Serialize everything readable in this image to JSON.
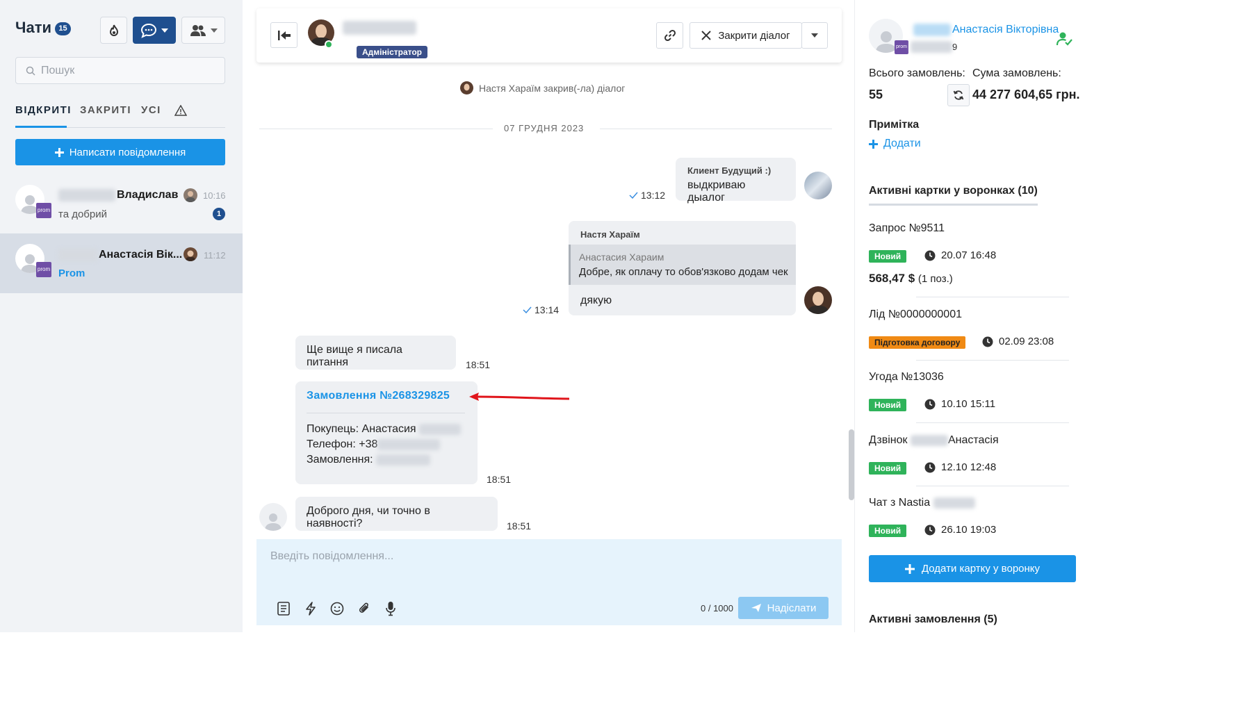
{
  "sidebar": {
    "title": "Чати",
    "chat_count": "15",
    "search_placeholder": "Пошук",
    "tabs": [
      "ВІДКРИТІ",
      "ЗАКРИТІ",
      "УСІ"
    ],
    "new_message_label": "Написати повідомлення",
    "chats": [
      {
        "name": "Владислав",
        "time": "10:16",
        "preview": "та добрий",
        "unread": "1",
        "source": "prom"
      },
      {
        "name": "Анастасія Вік...",
        "time": "11:12",
        "preview": "Prom",
        "source": "prom"
      }
    ]
  },
  "header": {
    "role_badge": "Адміністратор",
    "close_dialog_label": "Закрити діалог"
  },
  "conversation": {
    "system_note": "Настя Хараїм закрив(-ла) діалог",
    "date_separator": "07 ГРУДНЯ 2023",
    "messages": [
      {
        "author": "Клиент Будущий :)",
        "text": "выдкриваю дыалог",
        "time": "13:12"
      },
      {
        "author": "Настя Хараїм",
        "quote_author": "Анастасия Хараим",
        "quote_text": "Добре, як оплачу то обов'язково додам чек",
        "text": "дякую",
        "time": "13:14"
      },
      {
        "text": "Ще вище я писала питання",
        "time": "18:51"
      },
      {
        "order_link": "Замовлення №268329825",
        "buyer_label": "Покупець: Анастасия",
        "phone_label": "Телефон: +38",
        "order_label": "Замовлення:",
        "time": "18:51"
      },
      {
        "text": "Доброго дня, чи точно в наявності?",
        "time": "18:51"
      }
    ]
  },
  "composer": {
    "placeholder": "Введіть повідомлення...",
    "char_count": "0 / 1000",
    "send_label": "Надіслати"
  },
  "customer": {
    "name": "Анастасія Вікторівна",
    "phone_suffix": "9",
    "total_orders_label": "Всього замовлень:",
    "total_orders_value": "55",
    "orders_sum_label": "Сума замовлень:",
    "orders_sum_value": "44 277 604,65 грн.",
    "note_heading": "Примітка",
    "note_add": "Додати",
    "funnel_heading": "Активні картки у воронках (10)",
    "cards": [
      {
        "title": "Запрос №9511",
        "status": "Новий",
        "date": "20.07 16:48",
        "amount": "568,47 $",
        "positions": "(1 поз.)"
      },
      {
        "title": "Лід №0000000001",
        "status": "Підготовка договору",
        "date": "02.09 23:08"
      },
      {
        "title": "Угода №13036",
        "status": "Новий",
        "date": "10.10 15:11"
      },
      {
        "title": "Дзвінок",
        "title_suffix": "Анастасія",
        "status": "Новий",
        "date": "12.10 12:48"
      },
      {
        "title": "Чат з Nastia",
        "status": "Новий",
        "date": "26.10 19:03"
      }
    ],
    "add_card_label": "Додати картку у воронку",
    "orders_heading": "Активні замовлення (5)"
  },
  "colors": {
    "accent": "#1a93e6",
    "navy": "#1f4f8f",
    "status_new": "#2fb35a",
    "status_contract": "#f08a14",
    "annotation_arrow": "#e0151b"
  }
}
